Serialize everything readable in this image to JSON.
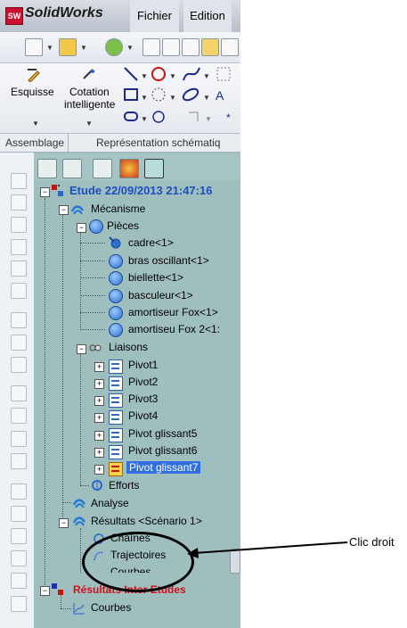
{
  "app": {
    "logo": "SW",
    "name": "SolidWorks"
  },
  "menu": {
    "fichier": "Fichier",
    "edition": "Edition"
  },
  "toolbar": {
    "esquisse": "Esquisse",
    "cotation_line1": "Cotation",
    "cotation_line2": "intelligente"
  },
  "tabs": [
    "Assemblage",
    "Représentation schématiq"
  ],
  "tree": {
    "root": "Etude 22/09/2013 21:47:16",
    "mecanisme": "Mécanisme",
    "pieces": "Pièces",
    "parts": [
      "cadre<1>",
      "bras oscillant<1>",
      "biellette<1>",
      "basculeur<1>",
      "amortiseur Fox<1>",
      "amortiseu Fox 2<1:"
    ],
    "liaisons": "Liaisons",
    "links": [
      "Pivot1",
      "Pivot2",
      "Pivot3",
      "Pivot4",
      "Pivot glissant5",
      "Pivot glissant6",
      "Pivot glissant7"
    ],
    "efforts": "Efforts",
    "analyse": "Analyse",
    "resultats": "Résultats <Scénario 1>",
    "chaines": "Chaînes",
    "trajectoires": "Trajectoires",
    "courbes_partial": "Courbes",
    "inter": "Résultats Inter Etudes",
    "courbes": "Courbes"
  },
  "annotation": {
    "label": "Clic droit"
  },
  "colors": {
    "panel_bg": "#9fbebe",
    "selected": "#2f6fe0",
    "root_text": "#1d4fbf",
    "inter_text": "#d0101a"
  }
}
